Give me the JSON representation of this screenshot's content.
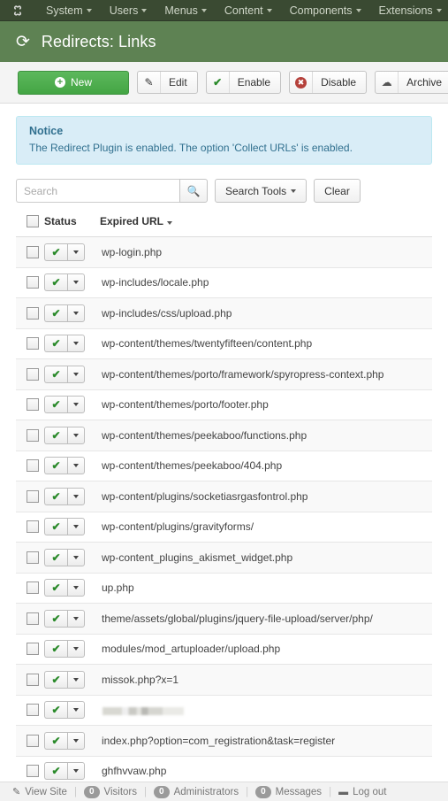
{
  "menubar": {
    "logo_name": "joomla-logo",
    "items": [
      {
        "label": "System",
        "caret": true
      },
      {
        "label": "Users",
        "caret": true
      },
      {
        "label": "Menus",
        "caret": true
      },
      {
        "label": "Content",
        "caret": true
      },
      {
        "label": "Components",
        "caret": true
      },
      {
        "label": "Extensions",
        "caret": true
      }
    ]
  },
  "pagehead": {
    "title": "Redirects: Links",
    "icon": "refresh-icon"
  },
  "toolbar": {
    "new_label": "New",
    "edit_label": "Edit",
    "enable_label": "Enable",
    "disable_label": "Disable",
    "archive_label": "Archive",
    "options_label": ""
  },
  "notice": {
    "title": "Notice",
    "text": "The Redirect Plugin is enabled. The option 'Collect URLs' is enabled."
  },
  "search": {
    "placeholder": "Search",
    "value": "",
    "search_tools_label": "Search Tools",
    "clear_label": "Clear"
  },
  "table": {
    "headers": {
      "checkbox": "",
      "status": "Status",
      "expired_url": "Expired URL"
    },
    "rows": [
      {
        "url": "wp-login.php",
        "status": "enabled",
        "redacted": false
      },
      {
        "url": "wp-includes/locale.php",
        "status": "enabled",
        "redacted": false
      },
      {
        "url": "wp-includes/css/upload.php",
        "status": "enabled",
        "redacted": false
      },
      {
        "url": "wp-content/themes/twentyfifteen/content.php",
        "status": "enabled",
        "redacted": false
      },
      {
        "url": "wp-content/themes/porto/framework/spyropress-context.php",
        "status": "enabled",
        "redacted": false
      },
      {
        "url": "wp-content/themes/porto/footer.php",
        "status": "enabled",
        "redacted": false
      },
      {
        "url": "wp-content/themes/peekaboo/functions.php",
        "status": "enabled",
        "redacted": false
      },
      {
        "url": "wp-content/themes/peekaboo/404.php",
        "status": "enabled",
        "redacted": false
      },
      {
        "url": "wp-content/plugins/socketiasrgasfontrol.php",
        "status": "enabled",
        "redacted": false
      },
      {
        "url": "wp-content/plugins/gravityforms/",
        "status": "enabled",
        "redacted": false
      },
      {
        "url": "wp-content_plugins_akismet_widget.php",
        "status": "enabled",
        "redacted": false
      },
      {
        "url": "up.php",
        "status": "enabled",
        "redacted": false
      },
      {
        "url": "theme/assets/global/plugins/jquery-file-upload/server/php/",
        "status": "enabled",
        "redacted": false
      },
      {
        "url": "modules/mod_artuploader/upload.php",
        "status": "enabled",
        "redacted": false
      },
      {
        "url": "missok.php?x=1",
        "status": "enabled",
        "redacted": false
      },
      {
        "url": "",
        "status": "enabled",
        "redacted": true
      },
      {
        "url": "index.php?option=com_registration&task=register",
        "status": "enabled",
        "redacted": false
      },
      {
        "url": "ghfhvvaw.php",
        "status": "enabled",
        "redacted": false
      }
    ]
  },
  "footer": {
    "view_site": "View Site",
    "visitors_count": "0",
    "visitors_label": "Visitors",
    "administrators_count": "0",
    "administrators_label": "Administrators",
    "messages_count": "0",
    "messages_label": "Messages",
    "logout_label": "Log out"
  },
  "colors": {
    "menubar_bg": "#3a4a32",
    "header_bg": "#5e8253",
    "new_button": "#49a349",
    "notice_bg": "#d9edf7",
    "notice_text": "#31708f",
    "status_tick": "#2a8a2a"
  }
}
